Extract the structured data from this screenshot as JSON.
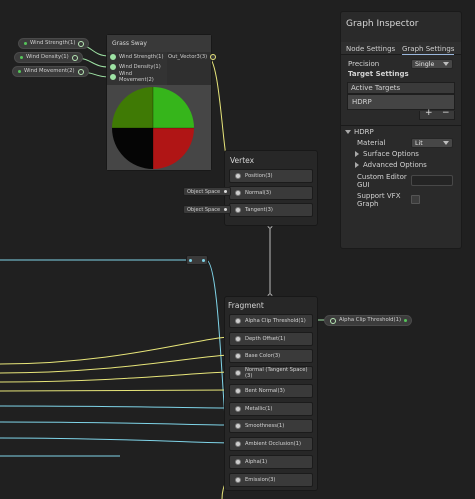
{
  "properties": [
    {
      "label": "Wind Strength(1)"
    },
    {
      "label": "Wind Density(1)"
    },
    {
      "label": "Wind Movement(2)"
    }
  ],
  "grass_node": {
    "title": "Grass Sway",
    "inputs": [
      "Wind Strength(1)",
      "Wind Density(1)",
      "Wind Movement(2)"
    ],
    "output": "Out_Vector3(3)"
  },
  "vertex_block": {
    "title": "Vertex",
    "slots": [
      "Position(3)",
      "Normal(3)",
      "Tangent(3)"
    ],
    "space_chips": [
      "Object Space",
      "Object Space"
    ]
  },
  "fragment_block": {
    "title": "Fragment",
    "slots": [
      "Alpha Clip Threshold(1)",
      "Depth Offset(1)",
      "Base Color(3)",
      "Normal (Tangent Space)(3)",
      "Bent Normal(3)",
      "Metallic(1)",
      "Smoothness(1)",
      "Ambient Occlusion(1)",
      "Alpha(1)",
      "Emission(3)"
    ],
    "alpha_clip_pill": "Alpha Clip Threshold(1)"
  },
  "inspector": {
    "title": "Graph Inspector",
    "tabs": [
      "Node Settings",
      "Graph Settings"
    ],
    "precision_label": "Precision",
    "precision_value": "Single",
    "target_settings_label": "Target Settings",
    "active_targets_label": "Active Targets",
    "active_target_item": "HDRP",
    "add_label": "+",
    "remove_label": "−",
    "hdrp_section": "HDRP",
    "material_label": "Material",
    "material_value": "Lit",
    "surface_options": "Surface Options",
    "advanced_options": "Advanced Options",
    "custom_editor_label": "Custom Editor GUI",
    "support_vfx_label": "Support VFX Graph"
  },
  "colors": {
    "green_wire": "#9ee2a4",
    "yellow_wire": "#e8e67a",
    "cyan_wire": "#7fd4e8",
    "white_wire": "#d0d0d0"
  }
}
